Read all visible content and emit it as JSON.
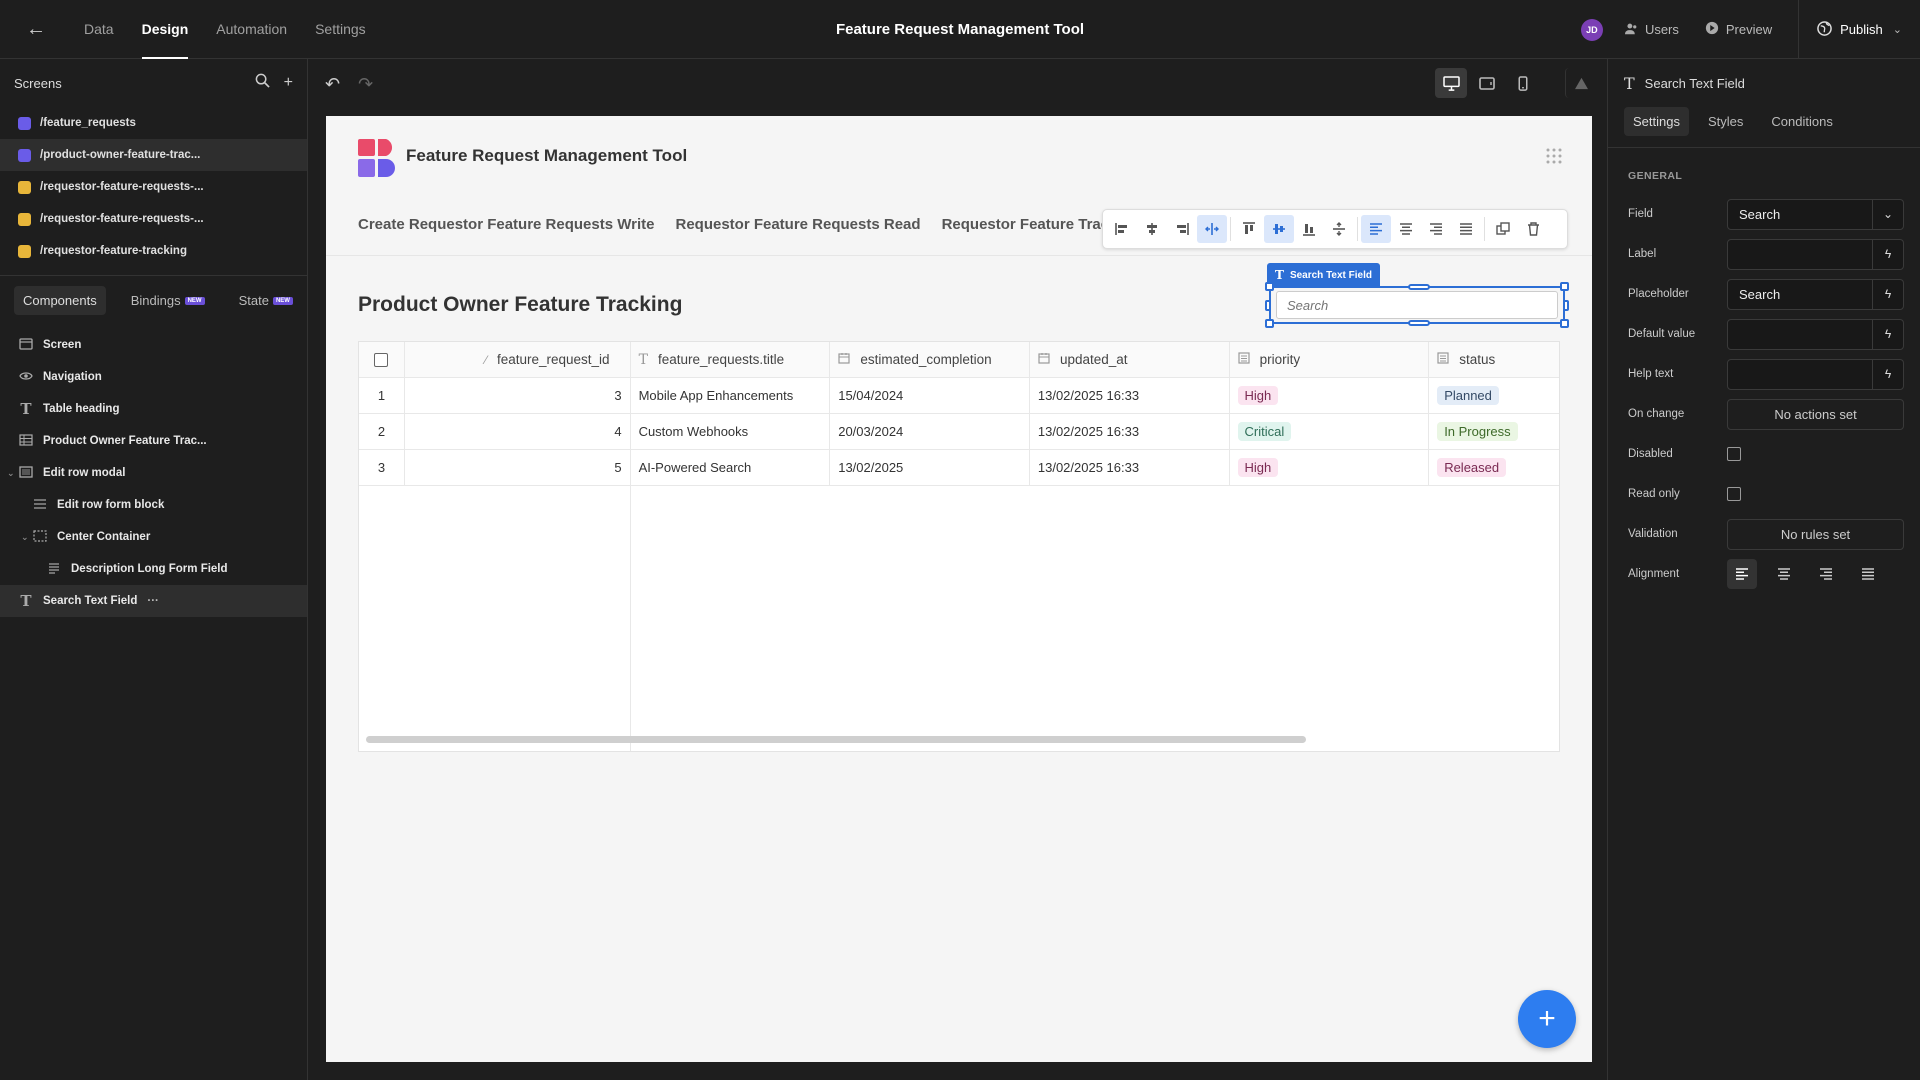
{
  "topbar": {
    "nav": [
      "Data",
      "Design",
      "Automation",
      "Settings"
    ],
    "active_nav": "Design",
    "title": "Feature Request Management Tool",
    "avatar": "JD",
    "users": "Users",
    "preview": "Preview",
    "publish": "Publish"
  },
  "screens": {
    "heading": "Screens",
    "items": [
      {
        "label": "/feature_requests",
        "color": "#6a5ce8"
      },
      {
        "label": "/product-owner-feature-trac...",
        "color": "#6a5ce8"
      },
      {
        "label": "/requestor-feature-requests-...",
        "color": "#e8b63a"
      },
      {
        "label": "/requestor-feature-requests-...",
        "color": "#e8b63a"
      },
      {
        "label": "/requestor-feature-tracking",
        "color": "#e8b63a"
      }
    ]
  },
  "left_tabs": {
    "components": "Components",
    "bindings": "Bindings",
    "state": "State",
    "new_badge": "NEW"
  },
  "components": [
    {
      "label": "Screen",
      "icon": "screen-icon",
      "indent": 0
    },
    {
      "label": "Navigation",
      "icon": "eye-icon",
      "indent": 0
    },
    {
      "label": "Table heading",
      "icon": "text-icon",
      "indent": 0
    },
    {
      "label": "Product Owner Feature Trac...",
      "icon": "table-icon",
      "indent": 0
    },
    {
      "label": "Edit row modal",
      "icon": "modal-icon",
      "indent": 0
    },
    {
      "label": "Edit row form block",
      "icon": "form-icon",
      "indent": 1
    },
    {
      "label": "Center Container",
      "icon": "container-icon",
      "indent": 1
    },
    {
      "label": "Description Long Form Field",
      "icon": "longform-icon",
      "indent": 2
    },
    {
      "label": "Search Text Field",
      "icon": "text-icon",
      "indent": 0
    }
  ],
  "canvas": {
    "brand": "Feature Request Management Tool",
    "links": [
      "Create Requestor Feature Requests Write",
      "Requestor Feature Requests Read",
      "Requestor Feature Tracking"
    ],
    "table_title": "Product Owner Feature Tracking",
    "selected_tag": "Search Text Field",
    "search_placeholder": "Search",
    "columns": [
      "feature_request_id",
      "feature_requests.title",
      "estimated_completion",
      "updated_at",
      "priority",
      "status"
    ],
    "rows": [
      {
        "index": "1",
        "id": "3",
        "title": "Mobile App Enhancements",
        "estimated": "15/04/2024",
        "updated": "13/02/2025 16:33",
        "priority": "High",
        "status": "Planned"
      },
      {
        "index": "2",
        "id": "4",
        "title": "Custom Webhooks",
        "estimated": "20/03/2024",
        "updated": "13/02/2025 16:33",
        "priority": "Critical",
        "status": "In Progress"
      },
      {
        "index": "3",
        "id": "5",
        "title": "AI-Powered Search",
        "estimated": "13/02/2025",
        "updated": "13/02/2025 16:33",
        "priority": "High",
        "status": "Released"
      }
    ]
  },
  "props": {
    "title": "Search Text Field",
    "tabs": [
      "Settings",
      "Styles",
      "Conditions"
    ],
    "section": "GENERAL",
    "field_label": "Field",
    "field_value": "Search",
    "label_label": "Label",
    "label_value": "",
    "placeholder_label": "Placeholder",
    "placeholder_value": "Search",
    "default_label": "Default value",
    "default_value": "",
    "help_label": "Help text",
    "help_value": "",
    "onchange_label": "On change",
    "onchange_value": "No actions set",
    "disabled_label": "Disabled",
    "readonly_label": "Read only",
    "validation_label": "Validation",
    "validation_value": "No rules set",
    "alignment_label": "Alignment"
  }
}
